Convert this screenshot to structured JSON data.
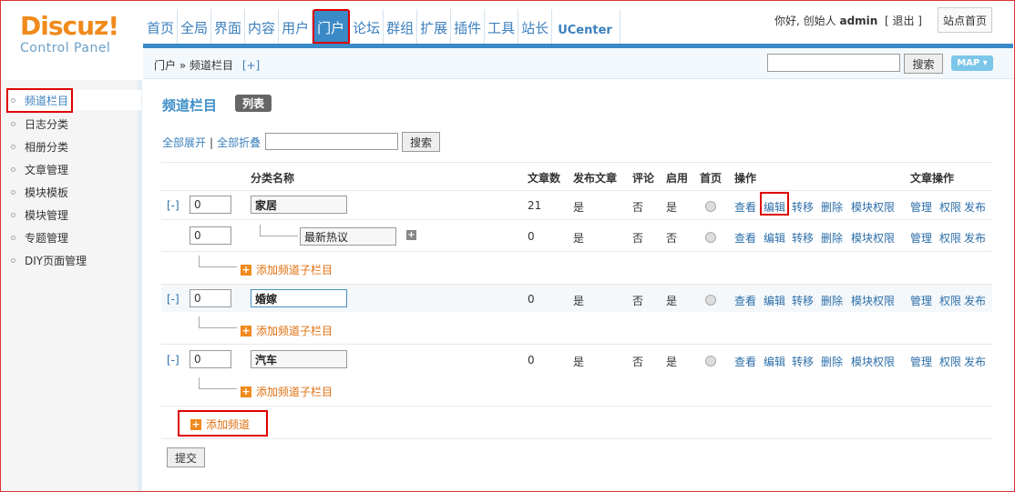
{
  "logo": {
    "main": "Discuz!",
    "sub": "Control Panel"
  },
  "nav": [
    "首页",
    "全局",
    "界面",
    "内容",
    "用户",
    "门户",
    "论坛",
    "群组",
    "扩展",
    "插件",
    "工具",
    "站长",
    "UCenter"
  ],
  "nav_active": "门户",
  "user": {
    "greeting": "你好, 创始人",
    "name": "admin",
    "logout": "[ 退出 ]",
    "site_home": "站点首页"
  },
  "breadcrumb": {
    "path": "门户 » 频道栏目",
    "add": "[+]"
  },
  "top_search": {
    "button": "搜索",
    "map": "MAP ▾"
  },
  "sidebar": [
    "频道栏目",
    "日志分类",
    "相册分类",
    "文章管理",
    "模块模板",
    "模块管理",
    "专题管理",
    "DIY页面管理"
  ],
  "page": {
    "title": "频道栏目",
    "badge": "列表",
    "expand_all": "全部展开",
    "separator": "|",
    "collapse_all": "全部折叠",
    "search_button": "搜索"
  },
  "columns": {
    "name": "分类名称",
    "articles": "文章数",
    "publish": "发布文章",
    "comment": "评论",
    "enabled": "启用",
    "home": "首页",
    "ops": "操作",
    "article_ops": "文章操作"
  },
  "ops_labels": {
    "view": "查看",
    "edit": "编辑",
    "move": "转移",
    "delete": "删除",
    "perm": "模块权限",
    "manage": "管理",
    "rights": "权限",
    "publish": "发布"
  },
  "rows": [
    {
      "expander": "[-]",
      "order": "0",
      "name": "家居",
      "articles": "21",
      "publish": "是",
      "comment": "否",
      "enabled": "是"
    },
    {
      "expander": "",
      "order": "0",
      "name": "最新热议",
      "articles": "0",
      "publish": "是",
      "comment": "否",
      "enabled": "否"
    },
    {
      "expander": "[-]",
      "order": "0",
      "name": "婚嫁",
      "articles": "0",
      "publish": "是",
      "comment": "否",
      "enabled": "是"
    },
    {
      "expander": "[-]",
      "order": "0",
      "name": "汽车",
      "articles": "0",
      "publish": "是",
      "comment": "否",
      "enabled": "是"
    }
  ],
  "add_sub": "添加频道子栏目",
  "add_channel": "添加频道",
  "submit": "提交"
}
